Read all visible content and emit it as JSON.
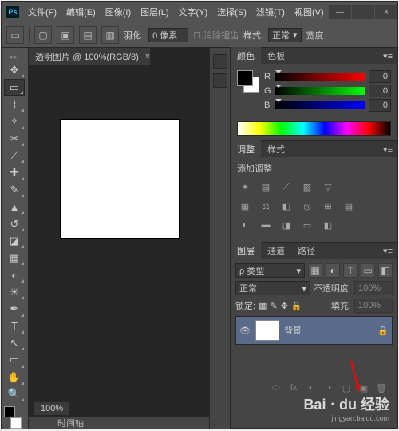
{
  "app": {
    "logo": "Ps"
  },
  "menu": [
    "文件(F)",
    "编辑(E)",
    "图像(I)",
    "图层(L)",
    "文字(Y)",
    "选择(S)",
    "滤镜(T)",
    "视图(V)"
  ],
  "winctrl": {
    "min": "—",
    "max": "□",
    "close": "×"
  },
  "options": {
    "feather_label": "羽化:",
    "feather_value": "0 像素",
    "antialias": "消除锯齿",
    "style_label": "样式:",
    "style_value": "正常",
    "width_label": "宽度:"
  },
  "document": {
    "tab": "透明图片 @ 100%(RGB/8)",
    "close": "×",
    "zoom": "100%"
  },
  "timeline": {
    "label": "时间轴"
  },
  "panel_color": {
    "tabs": [
      "颜色",
      "色板"
    ],
    "channels": [
      {
        "ch": "R",
        "val": "0",
        "grad": "linear-gradient(to right,#000,#f00)"
      },
      {
        "ch": "G",
        "val": "0",
        "grad": "linear-gradient(to right,#000,#0f0)"
      },
      {
        "ch": "B",
        "val": "0",
        "grad": "linear-gradient(to right,#000,#00f)"
      }
    ]
  },
  "panel_adjust": {
    "tabs": [
      "调整",
      "样式"
    ],
    "title": "添加调整"
  },
  "panel_layers": {
    "tabs": [
      "图层",
      "通道",
      "路径"
    ],
    "kind": "ρ 类型",
    "blend": "正常",
    "opacity_label": "不透明度:",
    "opacity_value": "100%",
    "lock_label": "锁定:",
    "fill_label": "填充:",
    "fill_value": "100%",
    "layer_name": "背景"
  },
  "watermark": {
    "brand": "Baiㆍdu 经验",
    "sub": "jingyan.baidu.com"
  }
}
